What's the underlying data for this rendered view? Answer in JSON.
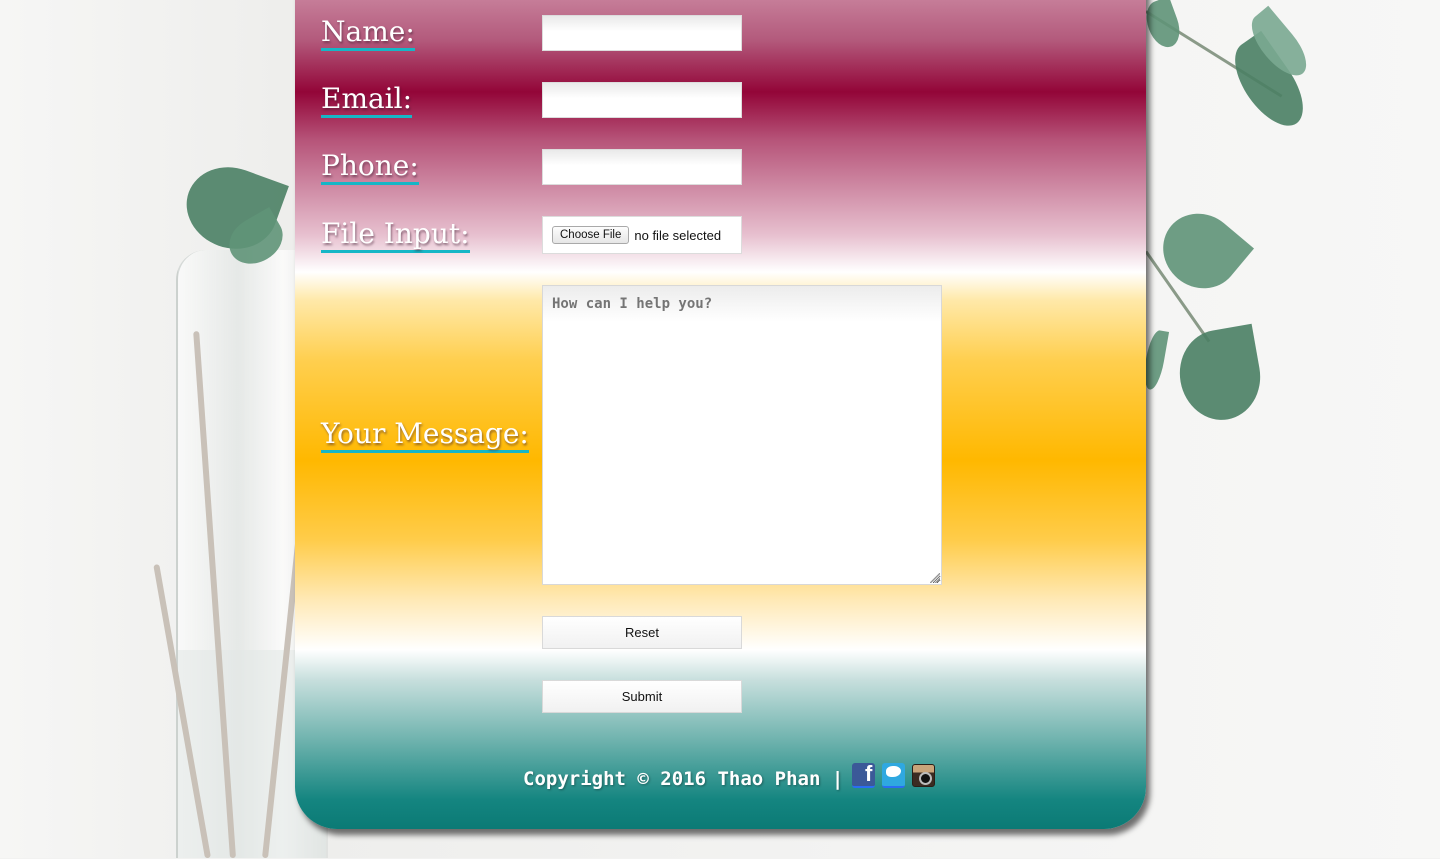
{
  "form": {
    "name_label": "Name:",
    "email_label": "Email:",
    "phone_label": "Phone:",
    "file_label": "File Input:",
    "message_label": "Your Message:",
    "name_value": "",
    "email_value": "",
    "phone_value": "",
    "file_button_label": "Choose File",
    "file_status": "no file selected",
    "message_placeholder": "How can I help you?",
    "reset_label": "Reset",
    "submit_label": "Submit"
  },
  "footer": {
    "copyright": "Copyright © 2016 Thao Phan |",
    "social": [
      "facebook-icon",
      "twitter-icon",
      "instagram-icon"
    ]
  },
  "colors": {
    "magenta": "#930538",
    "amber": "#ffb800",
    "teal": "#0b7a75",
    "label_underline": "#16b6c6"
  }
}
